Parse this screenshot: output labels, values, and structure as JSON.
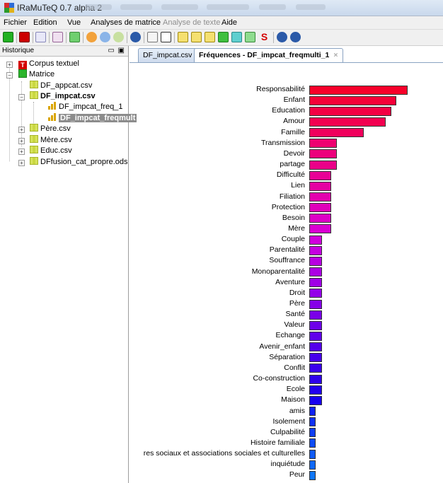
{
  "window": {
    "title": "IRaMuTeQ 0.7 alpha 2"
  },
  "menu": {
    "items": [
      "Fichier",
      "Edition",
      "Vue",
      "Analyses de matrice",
      "Analyse de texte",
      "Aide"
    ]
  },
  "history_panel": {
    "title": "Historique",
    "tree": [
      {
        "label": "Corpus textuel",
        "icon": "text-corpus-icon",
        "expander": "+"
      },
      {
        "label": "Matrice",
        "icon": "matrix-icon",
        "expander": "-"
      },
      {
        "label": "DF_appcat.csv",
        "icon": "spreadsheet-icon"
      },
      {
        "label": "DF_impcat.csv",
        "icon": "spreadsheet-icon",
        "expander": "-"
      },
      {
        "label": "DF_impcat_freq_1",
        "icon": "bar-chart-icon"
      },
      {
        "label": "DF_impcat_freqmult",
        "icon": "bar-chart-icon",
        "selected": true
      },
      {
        "label": "Père.csv",
        "icon": "spreadsheet-icon",
        "expander": "+"
      },
      {
        "label": "Mère.csv",
        "icon": "spreadsheet-icon",
        "expander": "+"
      },
      {
        "label": "Educ.csv",
        "icon": "spreadsheet-icon",
        "expander": "+"
      },
      {
        "label": "DFfusion_cat_propre.ods",
        "icon": "spreadsheet-icon",
        "expander": "+"
      }
    ]
  },
  "tabs": [
    {
      "label": "DF_impcat.csv",
      "active": false
    },
    {
      "label": "Fréquences - DF_impcat_freqmulti_1",
      "active": true,
      "close": "×"
    }
  ],
  "chart_data": {
    "type": "bar",
    "orientation": "horizontal",
    "categories": [
      "Responsabilité",
      "Enfant",
      "Education",
      "Amour",
      "Famille",
      "Transmission",
      "Devoir",
      "partage",
      "Difficulté",
      "Lien",
      "Filiation",
      "Protection",
      "Besoin",
      "Mère",
      "Couple",
      "Parentalité",
      "Souffrance",
      "Monoparentalité",
      "Aventure",
      "Droit",
      "Père",
      "Santé",
      "Valeur",
      "Echange",
      "Avenir_enfant",
      "Séparation",
      "Conflit",
      "Co-construction",
      "Ecole",
      "Maison",
      "amis",
      "Isolement",
      "Culpabilité",
      "Histoire familiale",
      "res sociaux et associations sociales et culturelles",
      "inquiétude",
      "Peur"
    ],
    "values": [
      9,
      8,
      7.5,
      7,
      5,
      2.5,
      2.5,
      2.5,
      2,
      2,
      2,
      2,
      2,
      2,
      1.2,
      1.2,
      1.2,
      1.2,
      1.2,
      1.2,
      1.2,
      1.2,
      1.2,
      1.2,
      1.2,
      1.2,
      1.2,
      1.2,
      1.2,
      1.2,
      0.6,
      0.6,
      0.6,
      0.6,
      0.6,
      0.6,
      0.6
    ],
    "colors": [
      "#f7002a",
      "#f50038",
      "#f40044",
      "#f20050",
      "#f0005c",
      "#ee0070",
      "#ec007c",
      "#ea0088",
      "#e80096",
      "#e500a2",
      "#e300ae",
      "#e000ba",
      "#dd00c6",
      "#da00d2",
      "#d000dc",
      "#c500e0",
      "#b800e2",
      "#ac00e4",
      "#a000e6",
      "#9400e8",
      "#8600e8",
      "#7a00e8",
      "#6e00e9",
      "#6000ea",
      "#5400ea",
      "#4700eb",
      "#3a00ec",
      "#2e00ec",
      "#2200ee",
      "#1800ef",
      "#0f22f1",
      "#0f30f2",
      "#0f3ef3",
      "#0f4cf4",
      "#0f5af5",
      "#0f68f6",
      "#0f76f6"
    ],
    "title": "",
    "xlabel": "",
    "ylabel": "",
    "grid": false,
    "legend": "none"
  }
}
